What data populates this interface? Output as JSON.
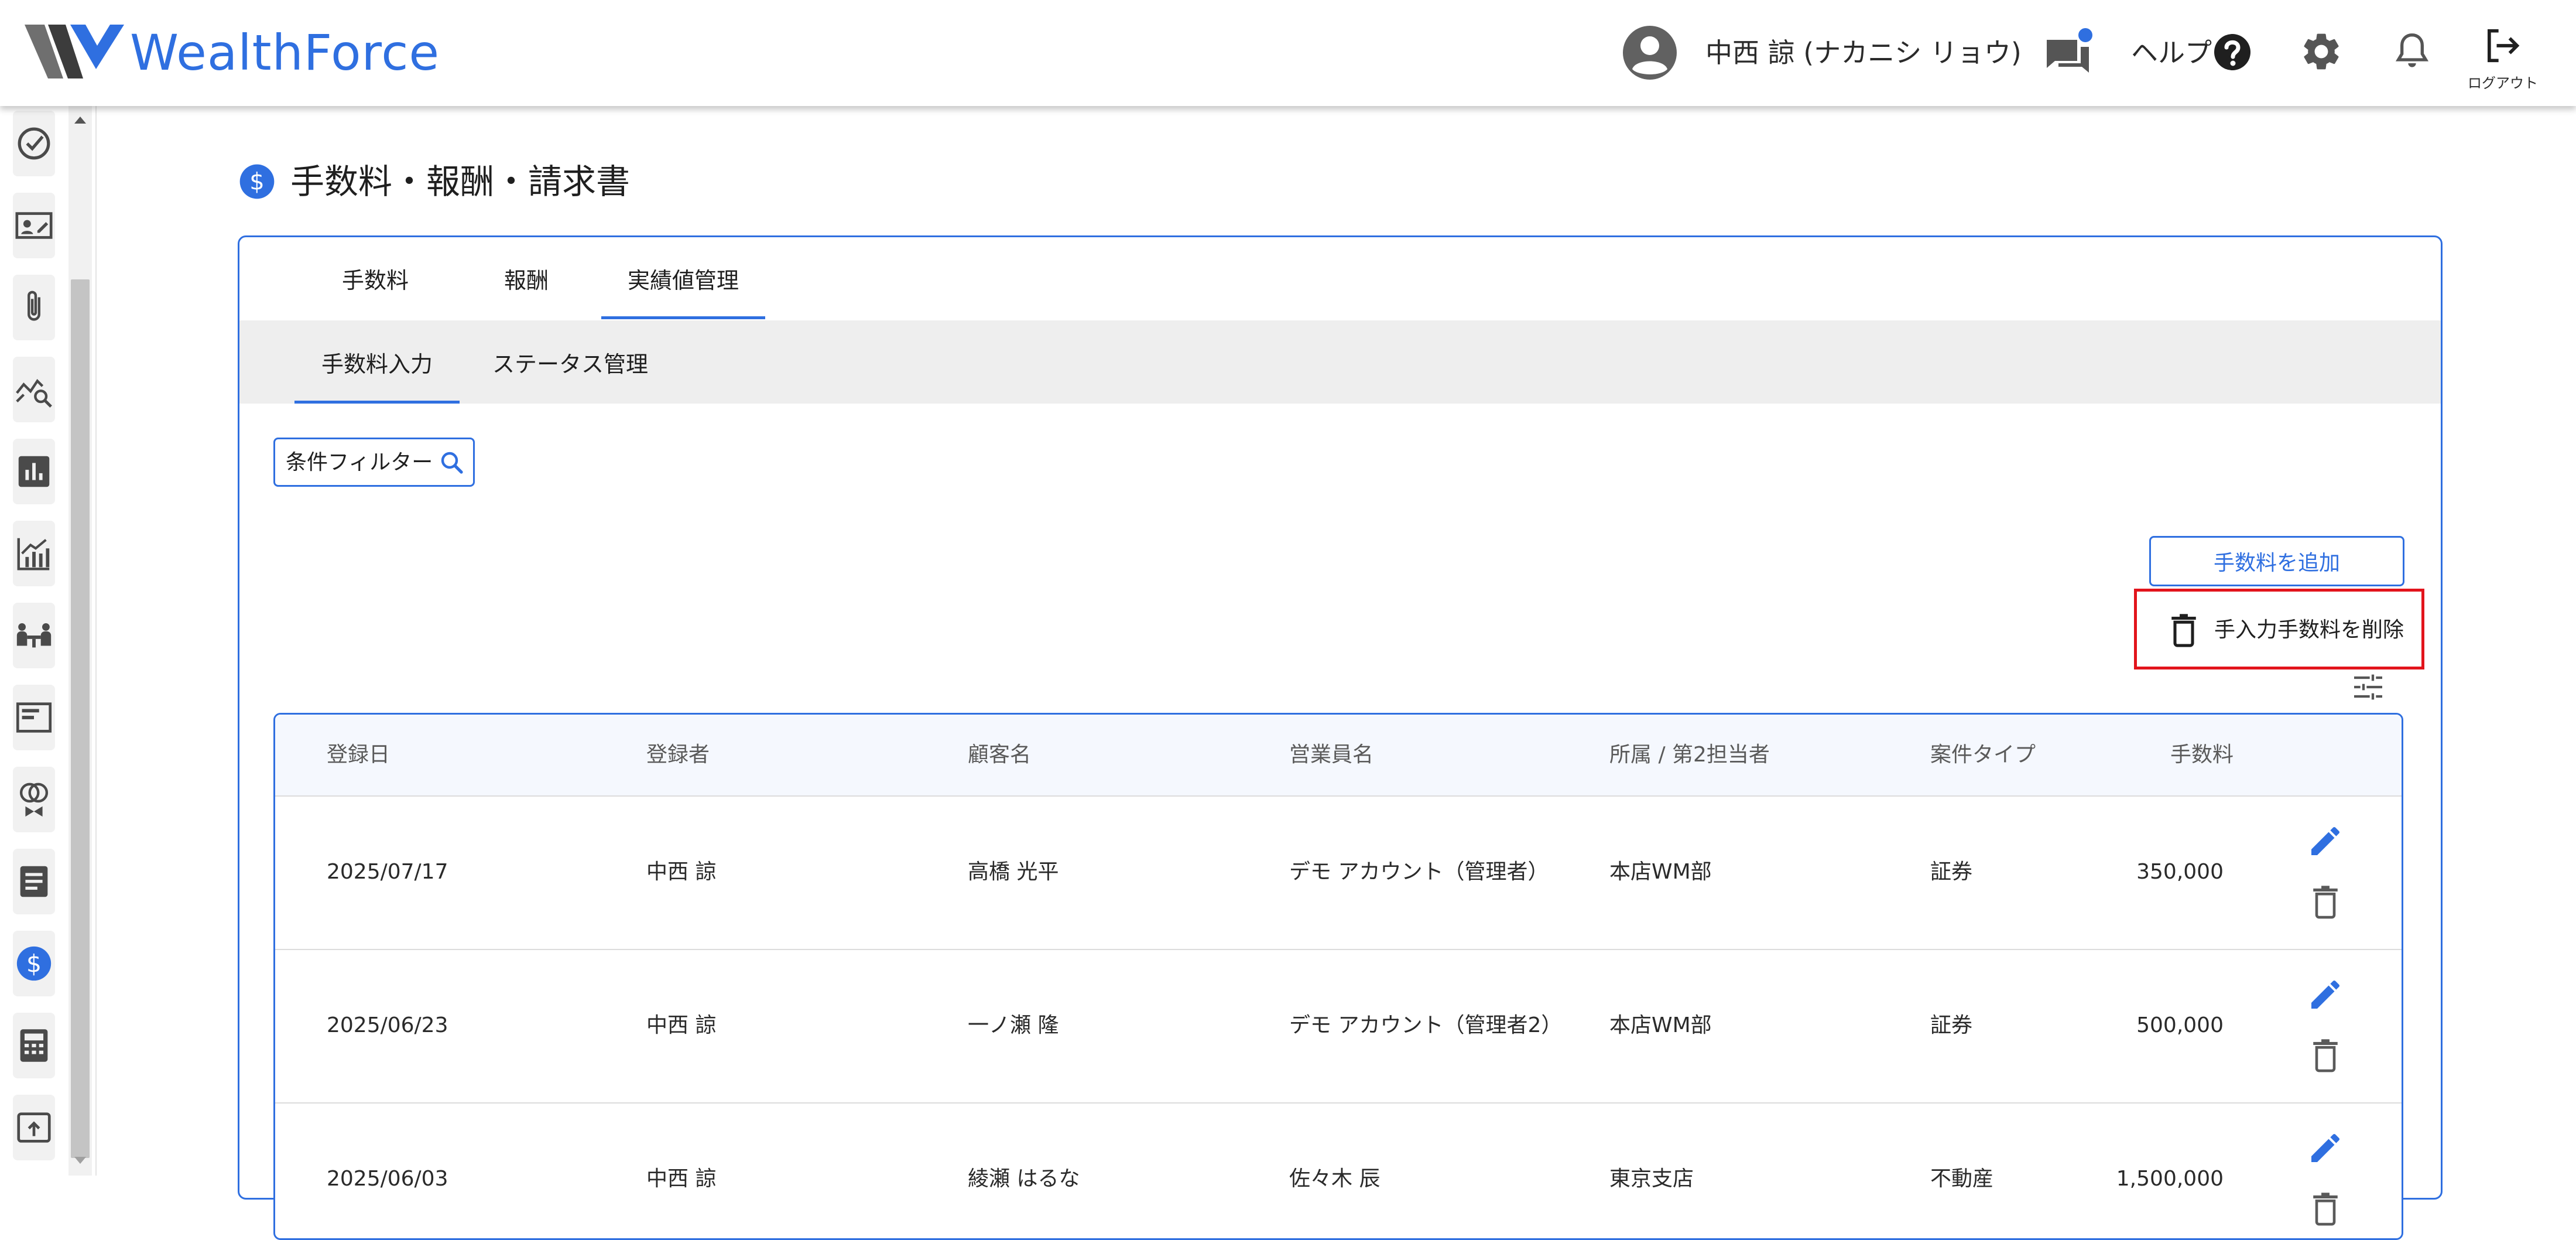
{
  "header": {
    "brand": "WealthForce",
    "user_name": "中西 諒 (ナカニシ リョウ)",
    "help_label": "ヘルプ",
    "logout_label": "ログアウト",
    "chat_badge_color": "#2f6fe0"
  },
  "sidebar": {
    "items": [
      {
        "icon": "check-circle-icon"
      },
      {
        "icon": "id-card-edit-icon"
      },
      {
        "icon": "paperclip-icon"
      },
      {
        "icon": "chart-search-icon"
      },
      {
        "icon": "bar-chart-box-icon"
      },
      {
        "icon": "growth-chart-icon"
      },
      {
        "icon": "meeting-icon"
      },
      {
        "icon": "document-card-icon"
      },
      {
        "icon": "rings-icon"
      },
      {
        "icon": "notes-icon"
      },
      {
        "icon": "dollar-icon",
        "active": true
      },
      {
        "icon": "calculator-icon"
      },
      {
        "icon": "upload-icon"
      }
    ]
  },
  "page": {
    "title": "手数料・報酬・請求書",
    "tabs": [
      "手数料",
      "報酬",
      "実績値管理"
    ],
    "active_tab": "実績値管理",
    "subtabs": [
      "手数料入力",
      "ステータス管理"
    ],
    "active_subtab": "手数料入力",
    "filter_label": "条件フィルター",
    "add_button": "手数料を追加",
    "delete_button": "手入力手数料を削除"
  },
  "table": {
    "columns": [
      "登録日",
      "登録者",
      "顧客名",
      "営業員名",
      "所属 / 第2担当者",
      "案件タイプ",
      "手数料"
    ],
    "rows": [
      [
        "2025/07/17",
        "中西 諒",
        "高橋 光平",
        "デモ アカウント（管理者）",
        "本店WM部",
        "証券",
        "350,000"
      ],
      [
        "2025/06/23",
        "中西 諒",
        "一ノ瀬 隆",
        "デモ アカウント（管理者2）",
        "本店WM部",
        "証券",
        "500,000"
      ],
      [
        "2025/06/03",
        "中西 諒",
        "綾瀬 はるな",
        "佐々木 辰",
        "東京支店",
        "不動産",
        "1,500,000"
      ]
    ]
  },
  "colors": {
    "accent": "#2f6fe0",
    "highlight_border": "#e2141c"
  }
}
